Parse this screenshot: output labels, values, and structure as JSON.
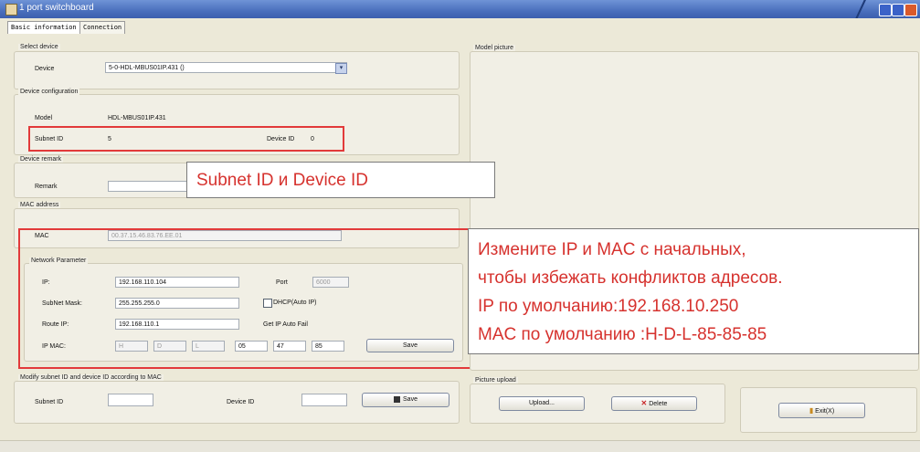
{
  "window": {
    "title": "1 port switchboard"
  },
  "tabs": [
    {
      "label": "Basic information"
    },
    {
      "label": "Connection"
    }
  ],
  "select_device": {
    "group_label": "Select device",
    "device_label": "Device",
    "device_value": "5-0-HDL-MBUS01IP.431 ()"
  },
  "device_config": {
    "group_label": "Device configuration",
    "model_label": "Model",
    "model_value": "HDL-MBUS01IP.431",
    "subnet_label": "Subnet ID",
    "subnet_value": "5",
    "device_label": "Device ID",
    "device_value": "0"
  },
  "remark": {
    "group_label": "Device remark",
    "remark_label": "Remark",
    "remark_value": ""
  },
  "mac": {
    "group_label": "MAC address",
    "mac_label": "MAC",
    "mac_value": "00.37.15.46.83.76.EE.01"
  },
  "network": {
    "group_label": "Network Parameter",
    "ip_label": "IP:",
    "ip_value": "192.168.110.104",
    "port_label": "Port",
    "port_value": "6000",
    "mask_label": "SubNet Mask:",
    "mask_value": "255.255.255.0",
    "dhcp_label": "DHCP(Auto IP)",
    "route_label": "Route IP:",
    "route_value": "192.168.110.1",
    "autofail_label": "Get IP Auto Fail",
    "ipmac_label": "IP MAC:",
    "ipmac_values": [
      "H",
      "D",
      "L",
      "05",
      "47",
      "85"
    ],
    "save_label": "Save"
  },
  "modify": {
    "group_label": "Modify subnet ID and device ID according to MAC",
    "subnet_label": "Subnet ID",
    "device_label": "Device ID",
    "save_label": "Save"
  },
  "model_picture": {
    "group_label": "Model picture"
  },
  "picture_upload": {
    "group_label": "Picture upload",
    "upload_label": "Upload...",
    "delete_label": "Delete"
  },
  "exit": {
    "label": "Exit(X)"
  },
  "annotations": {
    "subnet_note": "Subnet ID и Device ID",
    "ip_note_lines": [
      "Измените  IP  и  MAC  с  начальных,",
      "чтобы избежать конфликтов адресов.",
      "IP по умолчанию:192.168.10.250",
      "MAC по умолчанию :H-D-L-85-85-85"
    ]
  },
  "colors": {
    "annotation_red": "#d6322e",
    "titlebar_blue": "#4a6fbd"
  }
}
